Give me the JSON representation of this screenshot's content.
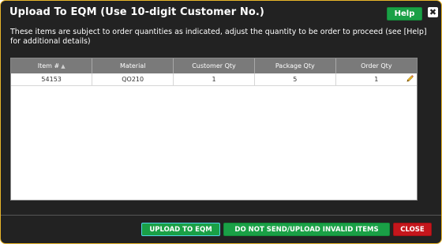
{
  "dialog": {
    "title": "Upload To EQM (Use 10-digit Customer No.)",
    "help_label": "Help",
    "close_glyph": "✖",
    "message": "These items are subject to order quantities as indicated, adjust the quantity to be order to proceed (see [Help] for additional details)"
  },
  "grid": {
    "columns": [
      "Item #",
      "Material",
      "Customer Qty",
      "Package Qty",
      "Order Qty"
    ],
    "sort_glyph": "▲",
    "rows": [
      {
        "item": "54153",
        "material": "QO210",
        "customer_qty": "1",
        "package_qty": "5",
        "order_qty": "1"
      }
    ],
    "edit_icon": "pencil-icon"
  },
  "footer": {
    "upload_label": "UPLOAD TO EQM",
    "donot_label": "DO NOT SEND/UPLOAD INVALID ITEMS",
    "close_label": "CLOSE"
  },
  "colors": {
    "accent_green": "#1aa046",
    "close_red": "#c4161c",
    "dialog_bg": "#222222",
    "border_gold": "#e8b52a"
  }
}
